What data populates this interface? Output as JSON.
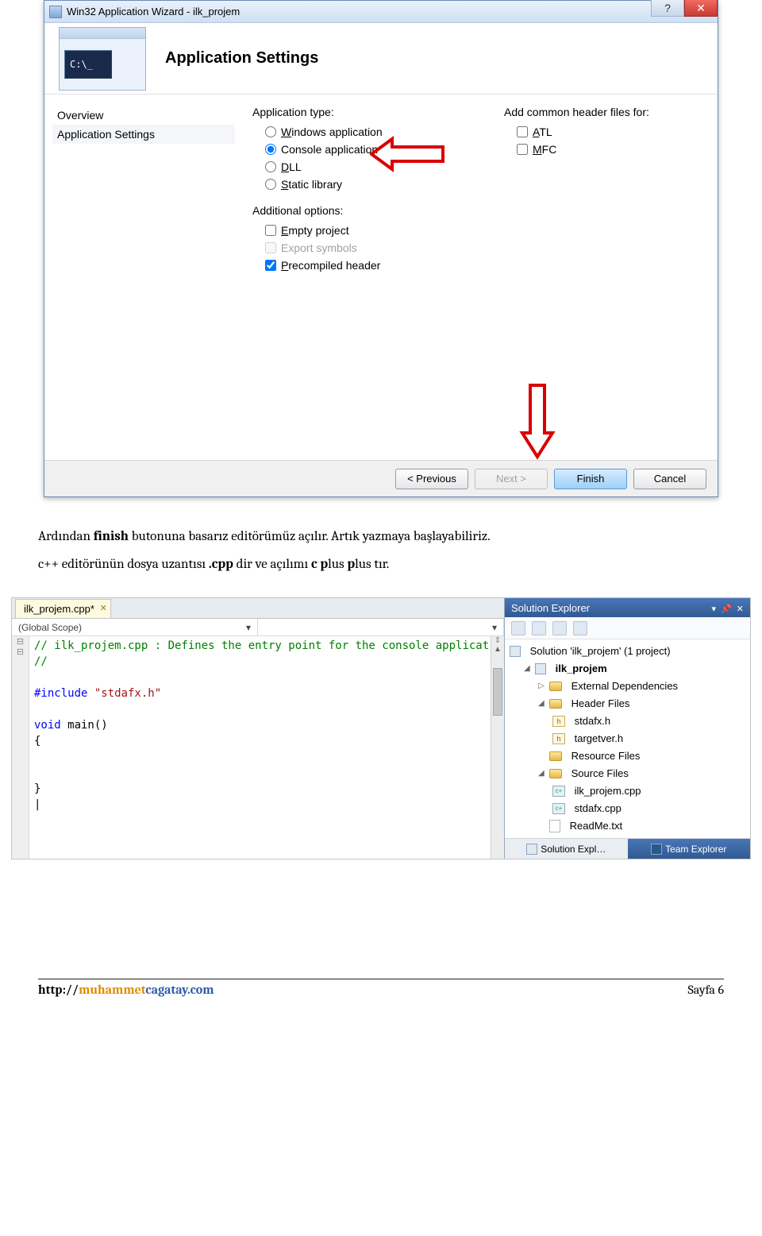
{
  "wizard": {
    "title": "Win32 Application Wizard - ilk_projem",
    "banner_title": "Application Settings",
    "cmd_label": "C:\\_",
    "sidebar": {
      "items": [
        {
          "label": "Overview"
        },
        {
          "label": "Application Settings"
        }
      ]
    },
    "appTypeLabel": "Application type:",
    "appTypes": [
      {
        "label": "Windows application"
      },
      {
        "label": "Console application"
      },
      {
        "label": "DLL"
      },
      {
        "label": "Static library"
      }
    ],
    "addlLabel": "Additional options:",
    "addlOptions": [
      {
        "label": "Empty project"
      },
      {
        "label": "Export symbols"
      },
      {
        "label": "Precompiled header"
      }
    ],
    "headersLabel": "Add common header files for:",
    "headers": [
      {
        "label": "ATL"
      },
      {
        "label": "MFC"
      }
    ],
    "buttons": {
      "prev": "< Previous",
      "next": "Next >",
      "finish": "Finish",
      "cancel": "Cancel"
    }
  },
  "doc": {
    "p1a": "Ardından ",
    "p1b": "finish",
    "p1c": " butonuna basarız editörümüz açılır. Artık yazmaya başlayabiliriz.",
    "p2a": "c++  editörünün dosya uzantısı ",
    "p2b": ".cpp",
    "p2c": "  dir ve açılımı ",
    "p2d": "c p",
    "p2e": "lus ",
    "p2f": "p",
    "p2g": "lus tır."
  },
  "vs": {
    "tab": "ilk_projem.cpp*",
    "scope": "(Global Scope)",
    "code_line1": "// ilk_projem.cpp : Defines the entry point for the console applicat",
    "code_line2": "//",
    "code_line3a": "#include ",
    "code_line3b": "\"stdafx.h\"",
    "code_line4a": "void",
    "code_line4b": " main()",
    "code_line5": "{",
    "code_line6": "}",
    "se": {
      "title": "Solution Explorer",
      "solution": "Solution 'ilk_projem' (1 project)",
      "project": "ilk_projem",
      "nodes": {
        "ext": "External Dependencies",
        "hdr": "Header Files",
        "hdr1": "stdafx.h",
        "hdr2": "targetver.h",
        "res": "Resource Files",
        "src": "Source Files",
        "src1": "ilk_projem.cpp",
        "src2": "stdafx.cpp",
        "readme": "ReadMe.txt"
      },
      "tabs": {
        "se": "Solution Expl…",
        "te": "Team Explorer"
      }
    }
  },
  "footer": {
    "url_http": "http://",
    "url_mid": "muhammet",
    "url_end": "cagatay.com",
    "page": "Sayfa 6"
  }
}
